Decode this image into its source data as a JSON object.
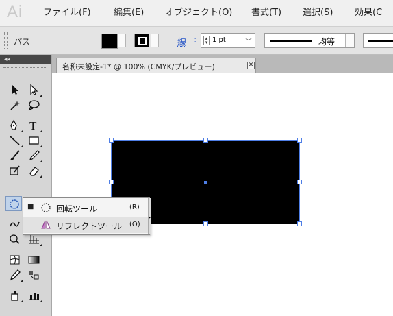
{
  "app": {
    "logo": "Ai"
  },
  "menubar": {
    "items": [
      "ファイル(F)",
      "編集(E)",
      "オブジェクト(O)",
      "書式(T)",
      "選択(S)",
      "効果(C"
    ]
  },
  "controlbar": {
    "selection_type": "パス",
    "stroke_label": "線",
    "stroke_colon": ":",
    "stroke_weight": "1 pt",
    "variable_width_profile": "均等",
    "fill_color": "#000000",
    "stroke_color": "#000000"
  },
  "document": {
    "tab_title": "名称未設定-1* @ 100% (CMYK/プレビュー)",
    "close_glyph": "✕",
    "shape_fill": "#000000",
    "selection_color": "#4e7ee6"
  },
  "tools": {
    "collapse_glyph": "◂◂",
    "items": [
      "selection-tool",
      "direct-selection-tool",
      "magic-wand-tool",
      "lasso-tool",
      "pen-tool",
      "type-tool",
      "line-segment-tool",
      "rectangle-tool",
      "paintbrush-tool",
      "pencil-tool",
      "blob-brush-tool",
      "eraser-tool",
      "rotate-tool",
      "scale-tool",
      "warp-tool",
      "free-transform-tool",
      "shape-builder-tool",
      "perspective-grid-tool",
      "mesh-tool",
      "gradient-tool",
      "eyedropper-tool",
      "blend-tool",
      "symbol-sprayer-tool",
      "column-graph-tool"
    ],
    "active": "rotate-tool"
  },
  "flyout": {
    "items": [
      {
        "label": "回転ツール",
        "shortcut": "(R)",
        "checked": true,
        "icon": "rotate-icon"
      },
      {
        "label": "リフレクトツール",
        "shortcut": "(O)",
        "checked": false,
        "icon": "reflect-icon"
      }
    ],
    "bullet": "■",
    "tearoff_glyph": "▸"
  }
}
